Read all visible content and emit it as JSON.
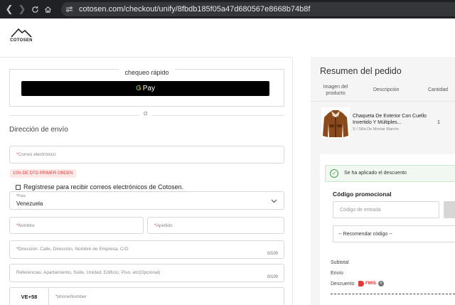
{
  "browser": {
    "url": "cotosen.com/checkout/unify/8fbdb185f05a47d680567e8668b74b8f",
    "back_glyph": "❮",
    "forward_glyph": "❯",
    "home_icon": "home-icon",
    "site_info_icon": "tune-icon"
  },
  "brand": {
    "logo_text": "COTOSEN"
  },
  "checkout": {
    "quick_title": "chequeo rápido",
    "gpay_g": "G",
    "gpay_label": "Pay",
    "or_text": "O",
    "shipping_title": "Dirección de envío",
    "email_placeholder": "Correo electrónico",
    "promo_badge": "10% DE DTO PRIMER ORDEN",
    "newsletter_label": "Regístrese para recibir correos electrónicos de Cotosen.",
    "country_label": "País",
    "country_value": "Venezuela",
    "first_name_placeholder": "Nombre",
    "last_name_placeholder": "Apellido",
    "address_placeholder": "Dirección: Calle, Dirección, Nombre de Empresa, C/O",
    "address_counter": "0/100",
    "references_placeholder": "Referencias: Apartamiento, Suite, Unidad, Edificio, Piso, etc(Opcional)",
    "references_counter": "0/100",
    "phone_code": "VE+58",
    "phone_placeholder": "phoneNumber",
    "required_mark": "*"
  },
  "summary": {
    "title": "Resumen del pedido",
    "col_image": "Imagen del producto",
    "col_description": "Descripción",
    "col_quantity": "Cantidad",
    "product": {
      "name": "Chaqueta De Exterior Con Cuello Invertido Y Múltiples...",
      "variant": "S / Silla De Montar Marrón",
      "quantity": "1"
    },
    "discount_applied": "Se ha aplicado el descuento",
    "promo_label": "Código promocional",
    "code_placeholder": "Código de entrada",
    "recommend_label": "-- Recomendar código --",
    "subtotal_label": "Subtotal",
    "shipping_label": "Envío",
    "discount_label": "Descuento",
    "discount_code": "FWIS"
  },
  "colors": {
    "accent_red": "#e53935",
    "success_green": "#43a047",
    "browser_bar": "#202124"
  }
}
